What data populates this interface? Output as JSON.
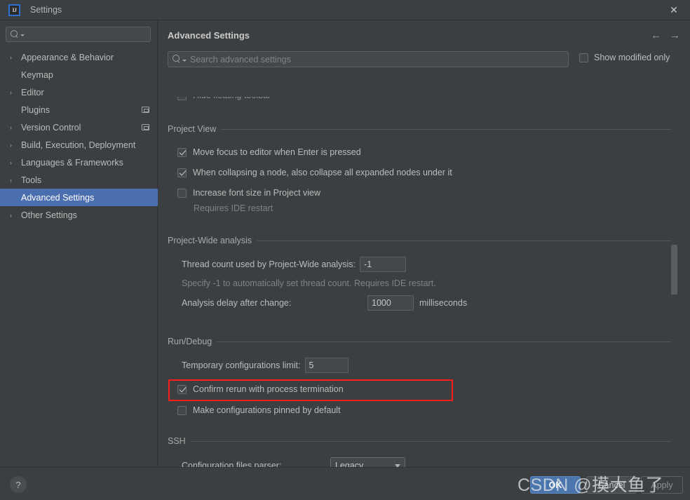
{
  "window": {
    "title": "Settings",
    "logo_text": "IJ",
    "close_label": "✕"
  },
  "sidebar": {
    "search_placeholder": "",
    "items": [
      {
        "label": "Appearance & Behavior",
        "arrow": "›",
        "expandable": true,
        "selected": false,
        "ext_icon": false
      },
      {
        "label": "Keymap",
        "arrow": "",
        "expandable": false,
        "selected": false,
        "ext_icon": false
      },
      {
        "label": "Editor",
        "arrow": "›",
        "expandable": true,
        "selected": false,
        "ext_icon": false
      },
      {
        "label": "Plugins",
        "arrow": "",
        "expandable": false,
        "selected": false,
        "ext_icon": true
      },
      {
        "label": "Version Control",
        "arrow": "›",
        "expandable": true,
        "selected": false,
        "ext_icon": true
      },
      {
        "label": "Build, Execution, Deployment",
        "arrow": "›",
        "expandable": true,
        "selected": false,
        "ext_icon": false
      },
      {
        "label": "Languages & Frameworks",
        "arrow": "›",
        "expandable": true,
        "selected": false,
        "ext_icon": false
      },
      {
        "label": "Tools",
        "arrow": "›",
        "expandable": true,
        "selected": false,
        "ext_icon": false
      },
      {
        "label": "Advanced Settings",
        "arrow": "",
        "expandable": false,
        "selected": true,
        "ext_icon": false
      },
      {
        "label": "Other Settings",
        "arrow": "›",
        "expandable": true,
        "selected": false,
        "ext_icon": false
      }
    ]
  },
  "header": {
    "title": "Advanced Settings",
    "back_arrow": "←",
    "forward_arrow": "→",
    "search_placeholder": "Search advanced settings",
    "show_modified_label": "Show modified only",
    "show_modified_checked": false
  },
  "clipped_top_row": {
    "label": "Hide floating toolbar",
    "checked": false
  },
  "sections": {
    "project_view": {
      "title": "Project View",
      "options": [
        {
          "label": "Move focus to editor when Enter is pressed",
          "checked": true
        },
        {
          "label": "When collapsing a node, also collapse all expanded nodes under it",
          "checked": true
        },
        {
          "label": "Increase font size in Project view",
          "checked": false
        }
      ],
      "hint": "Requires IDE restart"
    },
    "project_wide_analysis": {
      "title": "Project-Wide analysis",
      "thread_count_label": "Thread count used by Project-Wide analysis:",
      "thread_count_value": "-1",
      "thread_count_hint": "Specify -1 to automatically set thread count. Requires IDE restart.",
      "delay_label": "Analysis delay after change:",
      "delay_value": "1000",
      "delay_unit": "milliseconds"
    },
    "run_debug": {
      "title": "Run/Debug",
      "temp_limit_label": "Temporary configurations limit:",
      "temp_limit_value": "5",
      "options": [
        {
          "label": "Confirm rerun with process termination",
          "checked": true,
          "highlighted": true
        },
        {
          "label": "Make configurations pinned by default",
          "checked": false,
          "highlighted": false
        }
      ]
    },
    "ssh": {
      "title": "SSH",
      "parser_label": "Configuration files parser:",
      "parser_value": "Legacy"
    }
  },
  "footer": {
    "help_label": "?",
    "ok_label": "OK",
    "cancel_label": "Cancel",
    "apply_label": "Apply"
  },
  "watermark": {
    "text": "CSDN @摸大鱼了"
  },
  "colors": {
    "window_bg": "#3c3f41",
    "selection_blue": "#4b6eaf",
    "primary_button": "#4a76ad",
    "highlight_red": "#fc1d1d",
    "field_bg": "#45484a",
    "text": "#bbbbbb",
    "muted_text": "#7e8386"
  }
}
